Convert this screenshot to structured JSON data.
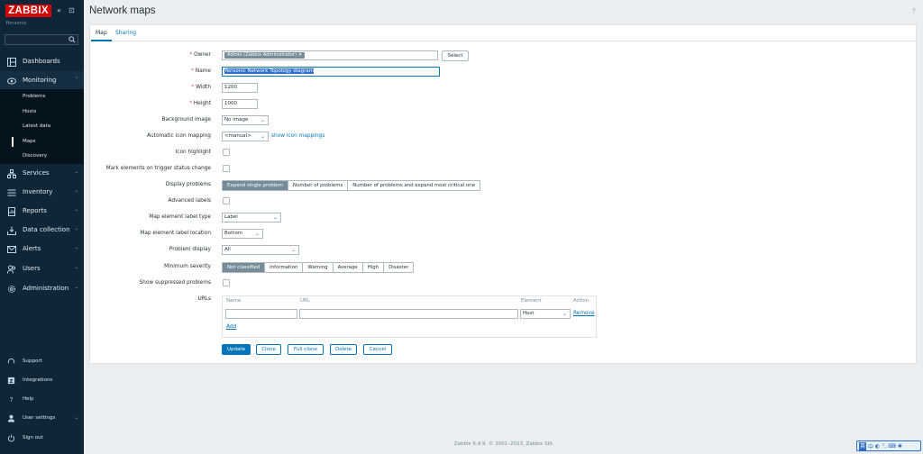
{
  "sidebar": {
    "logo": "ZABBIX",
    "collapse_icon": "«",
    "kiosk_icon": "⊡",
    "server_name": "Yensonic",
    "search_placeholder": "",
    "menu": [
      {
        "label": "Dashboards",
        "icon": "dashboard-icon",
        "chevron": ""
      },
      {
        "label": "Monitoring",
        "icon": "eye-icon",
        "chevron": "⌃"
      },
      {
        "label": "Services",
        "icon": "services-icon",
        "chevron": "⌄"
      },
      {
        "label": "Inventory",
        "icon": "inventory-icon",
        "chevron": "⌄"
      },
      {
        "label": "Reports",
        "icon": "reports-icon",
        "chevron": "⌄"
      },
      {
        "label": "Data collection",
        "icon": "data-collection-icon",
        "chevron": "⌄"
      },
      {
        "label": "Alerts",
        "icon": "alerts-icon",
        "chevron": "⌄"
      },
      {
        "label": "Users",
        "icon": "users-icon",
        "chevron": "⌄"
      },
      {
        "label": "Administration",
        "icon": "gear-icon",
        "chevron": "⌄"
      }
    ],
    "monitoring_sub": [
      "Problems",
      "Hosts",
      "Latest data",
      "Maps",
      "Discovery"
    ],
    "bottom": [
      {
        "label": "Support",
        "icon": "support-icon",
        "chevron": ""
      },
      {
        "label": "Integrations",
        "icon": "integrations-icon",
        "chevron": ""
      },
      {
        "label": "Help",
        "icon": "help-icon",
        "chevron": ""
      },
      {
        "label": "User settings",
        "icon": "user-icon",
        "chevron": "⌄"
      },
      {
        "label": "Sign out",
        "icon": "power-icon",
        "chevron": ""
      }
    ]
  },
  "header": {
    "title": "Network maps",
    "help": "?"
  },
  "tabs": {
    "map": "Map",
    "sharing": "Sharing"
  },
  "form": {
    "owner_label": "Owner",
    "owner_value": "Admin (Zabbix Administrator)",
    "owner_remove": "✕",
    "select_button": "Select",
    "name_label": "Name",
    "name_value": "Yensonic Network Topology diagram",
    "width_label": "Width",
    "width_value": "1200",
    "height_label": "Height",
    "height_value": "1000",
    "bg_label": "Background image",
    "bg_value": "No image",
    "icon_map_label": "Automatic icon mapping",
    "icon_map_value": "<manual>",
    "icon_map_link": "show icon mappings",
    "icon_highlight_label": "Icon highlight",
    "mark_label": "Mark elements on trigger status change",
    "display_problems_label": "Display problems",
    "display_problems_options": [
      "Expand single problem",
      "Number of problems",
      "Number of problems and expand most critical one"
    ],
    "advanced_labels_label": "Advanced labels",
    "label_type_label": "Map element label type",
    "label_type_value": "Label",
    "label_location_label": "Map element label location",
    "label_location_value": "Bottom",
    "problem_display_label": "Problem display",
    "problem_display_value": "All",
    "min_severity_label": "Minimum severity",
    "severity_options": [
      "Not classified",
      "Information",
      "Warning",
      "Average",
      "High",
      "Disaster"
    ],
    "suppressed_label": "Show suppressed problems",
    "urls_label": "URLs",
    "urls_headers": {
      "name": "Name",
      "url": "URL",
      "element": "Element",
      "action": "Action"
    },
    "urls_row": {
      "element": "Host",
      "remove": "Remove"
    },
    "urls_add": "Add"
  },
  "buttons": {
    "update": "Update",
    "clone": "Clone",
    "full_clone": "Full clone",
    "delete": "Delete",
    "cancel": "Cancel"
  },
  "footer": "Zabbix 6.4.9. © 2001–2023, Zabbix SIA",
  "ime": {
    "cn": "英",
    "zh": "中"
  },
  "colors": {
    "sidebar_bg": "#0e2638",
    "logo_red": "#d40000",
    "accent_blue": "#0275b8",
    "segment_selected": "#768d99"
  }
}
